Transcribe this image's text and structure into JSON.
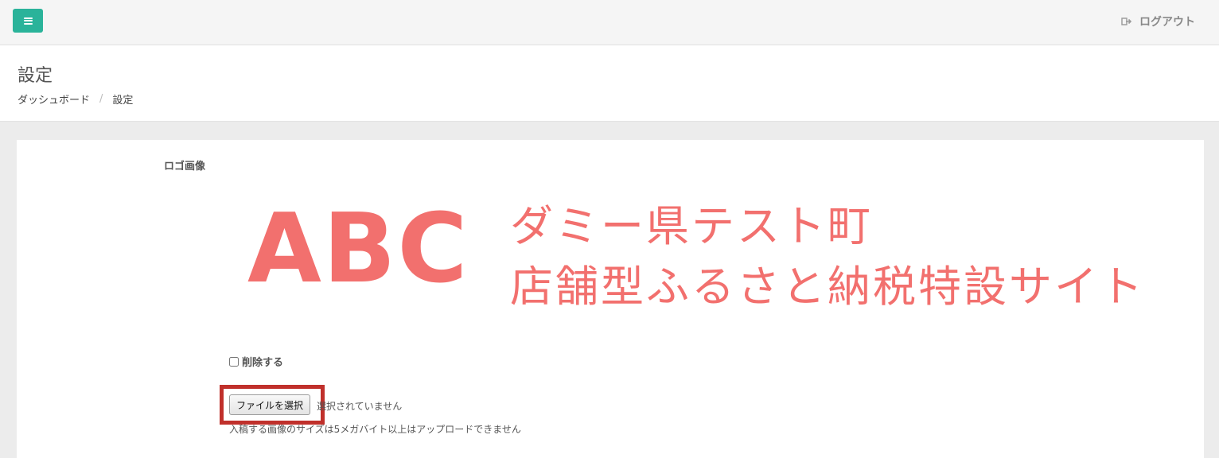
{
  "header": {
    "logout_label": "ログアウト"
  },
  "page": {
    "title": "設定",
    "breadcrumb": [
      {
        "label": "ダッシュボード"
      },
      {
        "label": "設定"
      }
    ],
    "breadcrumb_separator": "/"
  },
  "form": {
    "logo_label": "ロゴ画像",
    "logo_image": {
      "text_abc": "ABC",
      "line1": "ダミー県テスト町",
      "line2": "店舗型ふるさと納税特設サイト",
      "color": "#f2706e"
    },
    "delete_label": "削除する",
    "delete_checked": false,
    "file_button_label": "ファイルを選択",
    "file_status": "選択されていません",
    "help_text": "入稿する画像のサイズは5メガバイト以上はアップロードできません"
  },
  "colors": {
    "accent": "#2ab39a",
    "highlight": "#c0302b"
  },
  "icons": {
    "menu": "hamburger-icon",
    "logout": "sign-out-icon"
  }
}
